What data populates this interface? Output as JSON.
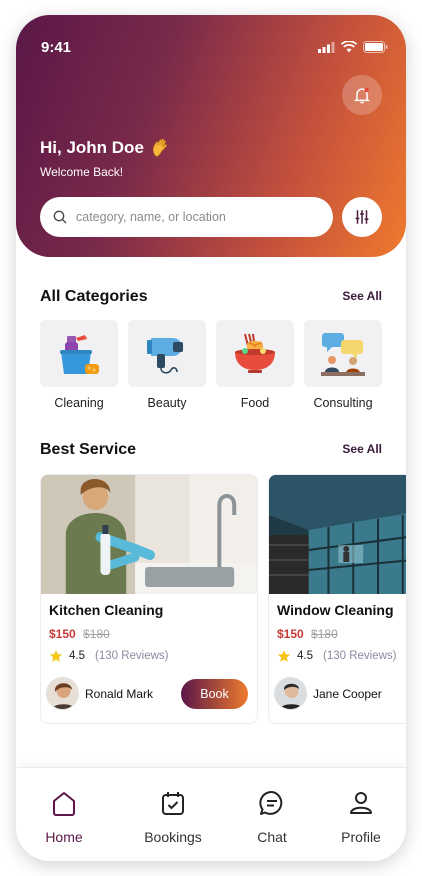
{
  "status": {
    "time": "9:41"
  },
  "header": {
    "greeting": "Hi, John Doe",
    "subtitle": "Welcome Back!",
    "search_placeholder": "category, name, or location"
  },
  "categories": {
    "title": "All Categories",
    "see_all": "See All",
    "items": [
      {
        "label": "Cleaning",
        "icon": "cleaning-bucket-icon"
      },
      {
        "label": "Beauty",
        "icon": "hair-dryer-icon"
      },
      {
        "label": "Food",
        "icon": "noodle-bowl-icon"
      },
      {
        "label": "Consulting",
        "icon": "consulting-chat-icon"
      }
    ]
  },
  "services": {
    "title": "Best Service",
    "see_all": "See All",
    "items": [
      {
        "title": "Kitchen Cleaning",
        "price": "$150",
        "old_price": "$180",
        "rating": "4.5",
        "reviews": "(130 Reviews)",
        "provider": "Ronald Mark",
        "book_label": "Book"
      },
      {
        "title": "Window Cleaning",
        "price": "$150",
        "old_price": "$180",
        "rating": "4.5",
        "reviews": "(130 Reviews)",
        "provider": "Jane Cooper"
      }
    ]
  },
  "nav": {
    "items": [
      {
        "label": "Home",
        "icon": "home-icon",
        "active": true
      },
      {
        "label": "Bookings",
        "icon": "calendar-check-icon"
      },
      {
        "label": "Chat",
        "icon": "chat-bubble-icon"
      },
      {
        "label": "Profile",
        "icon": "user-icon"
      }
    ]
  },
  "colors": {
    "gradient_start": "#5a1747",
    "gradient_end": "#ee7a2e",
    "price": "#c73a3a",
    "star": "#f5c518"
  }
}
